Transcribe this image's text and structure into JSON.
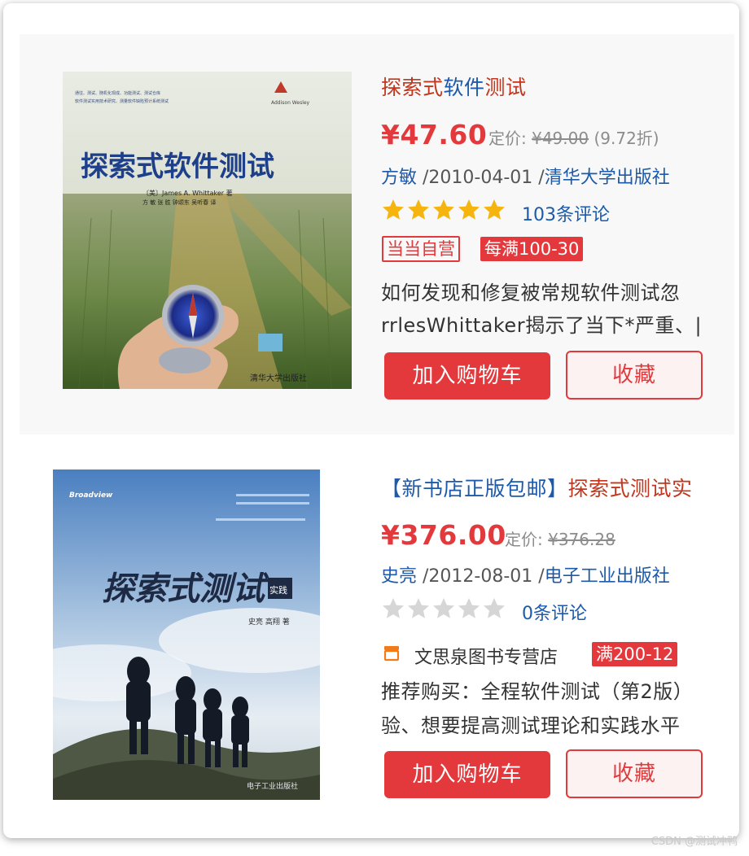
{
  "products": [
    {
      "title_parts": [
        {
          "text": "探索式",
          "color": "red"
        },
        {
          "text": "软件",
          "color": "blue"
        },
        {
          "text": "测试",
          "color": "red"
        }
      ],
      "price": "¥47.60",
      "list_price_label": "定价:",
      "list_price": "¥49.00",
      "discount": "(9.72折)",
      "author": "方敏",
      "date": " /2010-04-01 /",
      "publisher": "清华大学出版社",
      "rating_stars": 5,
      "reviews": "103条评论",
      "tag_outline": "当当自营",
      "tag_promo": "每满100-30",
      "desc_lines": [
        "如何发现和修复被常规软件测试忽",
        "rrlesWhittaker揭示了当下*严重、|"
      ],
      "add_cart": "加入购物车",
      "favorite": "收藏",
      "cover": {
        "title": "探索式软件测试",
        "authors": "〔美〕James A. Whittaker 著",
        "translators": "方 敏 张 胜 钟颂东 吴听春 译",
        "publisher": "清华大学出版社",
        "small_lines": [
          "通往、测试、随机化现成、功能测试、测试仓库",
          "软件测试实用技术研究、测量软件缺陷预计系统测试"
        ],
        "logo": "Addison Wesley"
      }
    },
    {
      "title_parts": [
        {
          "text": "【新书店正版包邮】",
          "color": "blue"
        },
        {
          "text": "探索式测试",
          "color": "red"
        },
        {
          "text": "实",
          "color": "red"
        }
      ],
      "price": "¥376.00",
      "list_price_label": "定价:",
      "list_price": "¥376.28",
      "discount": "",
      "author": "史亮",
      "date": " /2012-08-01 /",
      "publisher": "电子工业出版社",
      "rating_stars": 0,
      "reviews": "0条评论",
      "shop_name": "文思泉图书专营店",
      "tag_promo": "满200-12",
      "desc_lines": [
        "推荐购买：全程软件测试（第2版）",
        "验、想要提高测试理论和实践水平"
      ],
      "add_cart": "加入购物车",
      "favorite": "收藏",
      "cover": {
        "title": "探索式测试",
        "subtitle": "实践",
        "authors": "史亮 高翔 著",
        "publisher": "电子工业出版社",
        "logo": "Broadview"
      }
    }
  ],
  "colors": {
    "accent": "#e4393c",
    "link": "#1d5aa9",
    "title_red": "#c1361c",
    "star": "#f6b40e"
  },
  "watermark": "CSDN @测试冲鸭"
}
